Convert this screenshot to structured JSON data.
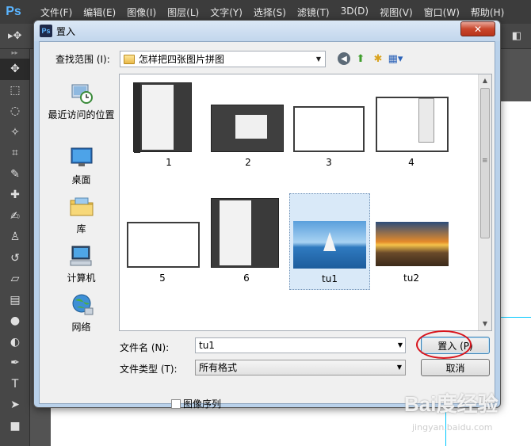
{
  "app": {
    "logo": "Ps",
    "menus": [
      "文件(F)",
      "编辑(E)",
      "图像(I)",
      "图层(L)",
      "文字(Y)",
      "选择(S)",
      "滤镜(T)",
      "3D(D)",
      "视图(V)",
      "窗口(W)",
      "帮助(H)"
    ]
  },
  "dialog": {
    "title": "置入",
    "close_label": "✕",
    "look_in_label": "查找范围 (I):",
    "look_in_value": "怎样把四张图片拼图",
    "places": [
      {
        "label": "最近访问的位置",
        "icon": "recent-places-icon"
      },
      {
        "label": "桌面",
        "icon": "desktop-icon"
      },
      {
        "label": "库",
        "icon": "libraries-icon"
      },
      {
        "label": "计算机",
        "icon": "computer-icon"
      },
      {
        "label": "网络",
        "icon": "network-icon"
      }
    ],
    "files": [
      {
        "name": "1",
        "kind": "screenshot-thumbnail"
      },
      {
        "name": "2",
        "kind": "screenshot-thumbnail"
      },
      {
        "name": "3",
        "kind": "screenshot-thumbnail"
      },
      {
        "name": "4",
        "kind": "screenshot-thumbnail"
      },
      {
        "name": "5",
        "kind": "screenshot-thumbnail"
      },
      {
        "name": "6",
        "kind": "screenshot-thumbnail"
      },
      {
        "name": "tu1",
        "kind": "sailboat-photo",
        "selected": true
      },
      {
        "name": "tu2",
        "kind": "sunset-photo"
      }
    ],
    "filename_label": "文件名 (N):",
    "filename_value": "tu1",
    "filetype_label": "文件类型 (T):",
    "filetype_value": "所有格式",
    "place_button": "置入 (P)",
    "cancel_button": "取消",
    "image_sequence_label": "图像序列",
    "image_sequence_checked": false
  },
  "watermark": {
    "text": "Bai度经验",
    "sub": "jingyan.baidu.com"
  },
  "colors": {
    "ps_dark": "#3c3c3c",
    "dialog_frame": "#b9d1ea",
    "highlight_circle": "#d8141c",
    "guide": "#00c8ff"
  }
}
